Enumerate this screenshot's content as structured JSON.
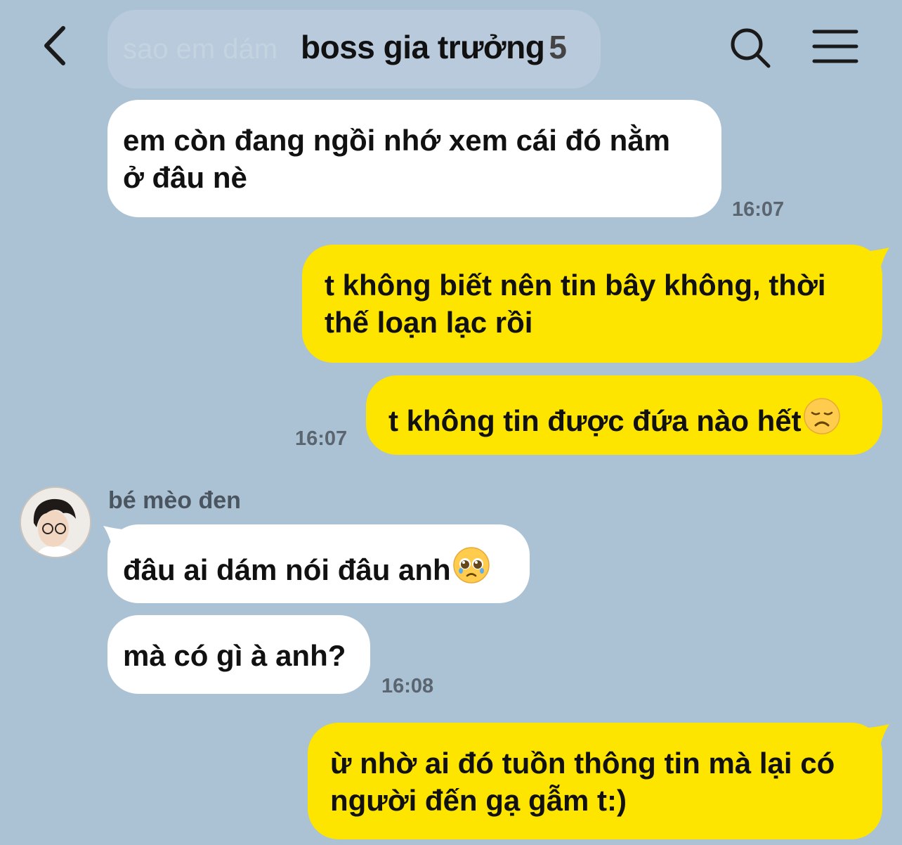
{
  "header": {
    "title": "boss gia trưởng",
    "member_count": "5",
    "back_icon": "chevron-left-icon",
    "search_icon": "search-icon",
    "menu_icon": "hamburger-menu-icon",
    "ghost_message": "sao em dám"
  },
  "colors": {
    "background": "#abc1d4",
    "incoming_bubble": "#ffffff",
    "outgoing_bubble": "#fee500"
  },
  "messages": [
    {
      "sender": "other",
      "lines": [
        "em còn đang ngồi nhớ xem cái đó nằm",
        "ở đâu nè"
      ],
      "time": "16:07"
    },
    {
      "sender": "me",
      "lines": [
        "t không biết nên tin bây không, thời",
        "thế loạn lạc rồi"
      ]
    },
    {
      "sender": "me",
      "text": "t không tin được đứa nào hết",
      "emoji": "disappointed-face-emoji",
      "time": "16:07"
    },
    {
      "sender_name": "bé mèo đen",
      "avatar": "avatar"
    },
    {
      "sender": "other",
      "text": "đâu ai dám nói đâu anh",
      "emoji": "pleading-face-emoji"
    },
    {
      "sender": "other",
      "text": "mà có gì à anh?",
      "time": "16:08"
    },
    {
      "sender": "me",
      "lines": [
        "ừ nhờ ai đó tuồn thông tin mà lại có",
        "người đến gạ gẫm t:)"
      ]
    }
  ]
}
